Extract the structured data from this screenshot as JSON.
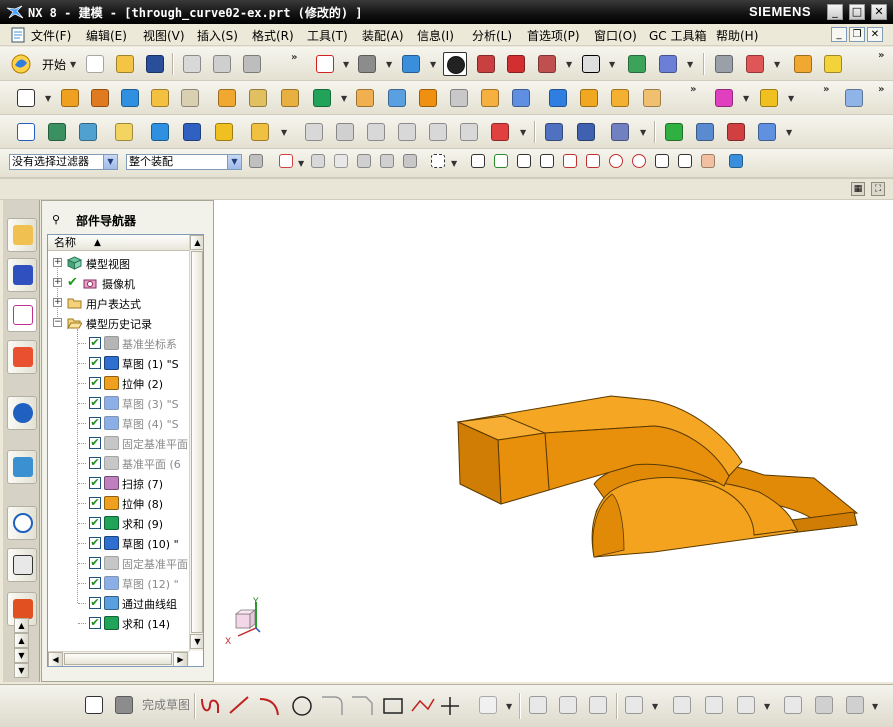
{
  "window": {
    "title": "NX 8 - 建模 - [through_curve02-ex.prt (修改的) ]",
    "brand": "SIEMENS"
  },
  "menubar": {
    "items": [
      "文件(F)",
      "编辑(E)",
      "视图(V)",
      "插入(S)",
      "格式(R)",
      "工具(T)",
      "装配(A)",
      "信息(I)",
      "分析(L)",
      "首选项(P)",
      "窗口(O)",
      "GC 工具箱",
      "帮助(H)"
    ]
  },
  "toolbar": {
    "start_label": "开始"
  },
  "selection_bar": {
    "filter_value": "没有选择过滤器",
    "scope_value": "整个装配"
  },
  "navigator": {
    "title": "部件导航器",
    "column_header": "名称",
    "nodes": [
      {
        "label": "模型视图",
        "checked": false,
        "dimmed": false,
        "icon": "model-views-icon"
      },
      {
        "label": "摄像机",
        "checked": true,
        "dimmed": false,
        "icon": "camera-icon"
      },
      {
        "label": "用户表达式",
        "checked": false,
        "dimmed": false,
        "icon": "folder-icon"
      },
      {
        "label": "模型历史记录",
        "checked": false,
        "dimmed": false,
        "icon": "folder-open-icon"
      }
    ],
    "history": [
      {
        "label": "基准坐标系",
        "dimmed": true,
        "icon": "datum-csys-icon"
      },
      {
        "label": "草图 (1) \"S",
        "dimmed": false,
        "icon": "sketch-icon"
      },
      {
        "label": "拉伸 (2)",
        "dimmed": false,
        "icon": "extrude-icon"
      },
      {
        "label": "草图 (3) \"S",
        "dimmed": true,
        "icon": "sketch-icon"
      },
      {
        "label": "草图 (4) \"S",
        "dimmed": true,
        "icon": "sketch-icon"
      },
      {
        "label": "固定基准平面",
        "dimmed": true,
        "icon": "datum-plane-icon"
      },
      {
        "label": "基准平面 (6",
        "dimmed": true,
        "icon": "datum-plane-icon"
      },
      {
        "label": "扫掠 (7)",
        "dimmed": false,
        "icon": "swept-icon"
      },
      {
        "label": "拉伸 (8)",
        "dimmed": false,
        "icon": "extrude-icon"
      },
      {
        "label": "求和 (9)",
        "dimmed": false,
        "icon": "unite-icon"
      },
      {
        "label": "草图 (10) \"",
        "dimmed": false,
        "icon": "sketch-icon"
      },
      {
        "label": "固定基准平面",
        "dimmed": true,
        "icon": "datum-plane-icon"
      },
      {
        "label": "草图 (12) \"",
        "dimmed": true,
        "icon": "sketch-icon"
      },
      {
        "label": "通过曲线组",
        "dimmed": false,
        "icon": "through-curves-icon"
      },
      {
        "label": "求和 (14)",
        "dimmed": false,
        "icon": "unite-icon"
      }
    ]
  },
  "sketch_bar": {
    "finish_sketch_label": "完成草图"
  },
  "triad": {
    "x": "X",
    "y": "Y",
    "z": "Z"
  },
  "colors": {
    "model_face_light": "#f5a623",
    "model_face_mid": "#e8900c",
    "model_face_dark": "#d07d05",
    "model_edge": "#5a3a00"
  }
}
